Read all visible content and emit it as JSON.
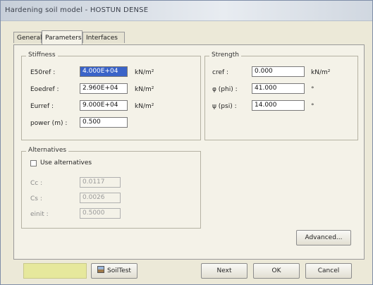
{
  "window": {
    "title": "Hardening soil model - HOSTUN DENSE"
  },
  "tabs": [
    {
      "label": "General"
    },
    {
      "label": "Parameters"
    },
    {
      "label": "Interfaces"
    }
  ],
  "stiffness": {
    "title": "Stiffness",
    "e50": {
      "label": "E50ref :",
      "value": "4.000E+04",
      "unit": "kN/m²"
    },
    "eoed": {
      "label": "Eoedref :",
      "value": "2.960E+04",
      "unit": "kN/m²"
    },
    "eur": {
      "label": "Eurref :",
      "value": "9.000E+04",
      "unit": "kN/m²"
    },
    "power": {
      "label": "power (m) :",
      "value": "0.500"
    }
  },
  "strength": {
    "title": "Strength",
    "cref": {
      "label": "cref :",
      "value": "0.000",
      "unit": "kN/m²"
    },
    "phi": {
      "label": "φ (phi) :",
      "value": "41.000",
      "unit": "°"
    },
    "psi": {
      "label": "ψ (psi) :",
      "value": "14.000",
      "unit": "°"
    }
  },
  "alternatives": {
    "title": "Alternatives",
    "use_label": "Use alternatives",
    "cc": {
      "label": "Cc :",
      "value": "0.0117"
    },
    "cs": {
      "label": "Cs :",
      "value": "0.0026"
    },
    "einit": {
      "label": "einit :",
      "value": "0.5000"
    }
  },
  "buttons": {
    "advanced": "Advanced...",
    "softest": "SoilTest",
    "next": "Next",
    "ok": "OK",
    "cancel": "Cancel"
  },
  "colors": {
    "selection": "#3a63c8",
    "status_swatch": "#e6e89c"
  }
}
